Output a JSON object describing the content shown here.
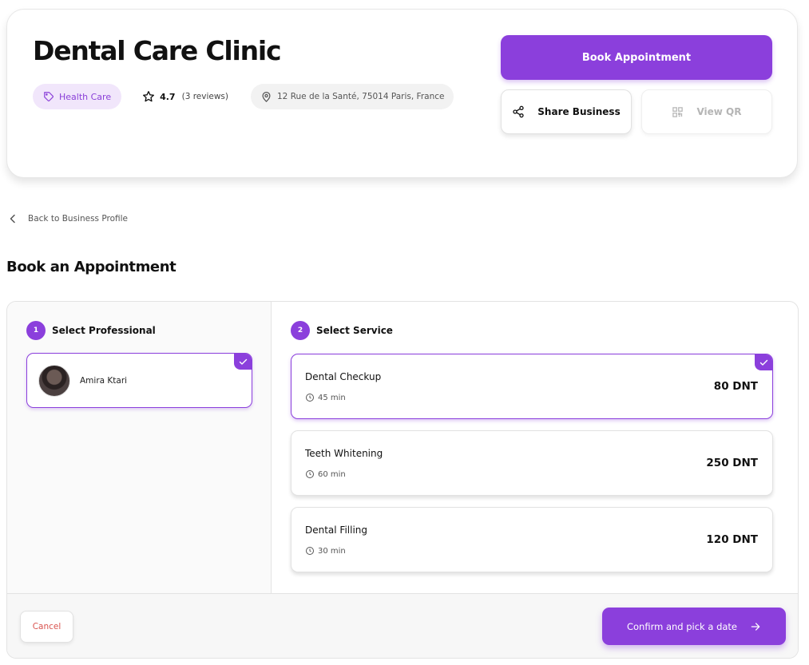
{
  "business": {
    "title": "Dental Care Clinic",
    "category": "Health Care",
    "rating": "4.7",
    "reviews": "(3 reviews)",
    "address": "12 Rue de la Santé, 75014 Paris, France"
  },
  "actions": {
    "book": "Book Appointment",
    "share": "Share Business",
    "qr": "View QR"
  },
  "nav": {
    "back": "Back to Business Profile"
  },
  "booking": {
    "title": "Book an Appointment",
    "step1": {
      "num": "1",
      "label": "Select Professional"
    },
    "step2": {
      "num": "2",
      "label": "Select Service"
    },
    "professional": {
      "name": "Amira Ktari",
      "selected": true
    },
    "services": [
      {
        "name": "Dental Checkup",
        "duration": "45 min",
        "price": "80 DNT",
        "selected": true
      },
      {
        "name": "Teeth Whitening",
        "duration": "60 min",
        "price": "250 DNT",
        "selected": false
      },
      {
        "name": "Dental Filling",
        "duration": "30 min",
        "price": "120 DNT",
        "selected": false
      }
    ],
    "cancel": "Cancel",
    "confirm": "Confirm and pick a date"
  },
  "colors": {
    "accent": "#8b3fdc",
    "accent_light": "#f1e6fb",
    "danger": "#d9534f"
  }
}
